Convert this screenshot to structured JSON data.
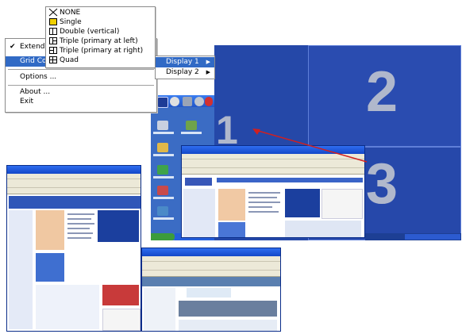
{
  "context_menu": {
    "items": [
      {
        "label": "Extend",
        "checked": true
      },
      {
        "label": "Grid Co",
        "highlighted": true
      },
      {
        "label": "Options ..."
      },
      {
        "label": "About ..."
      },
      {
        "label": "Exit"
      }
    ]
  },
  "grid_menu": {
    "items": [
      {
        "label": "NONE",
        "icon": "none-x-icon"
      },
      {
        "label": "Single",
        "icon": "single-grid-icon"
      },
      {
        "label": "Double (vertical)",
        "icon": "double-vertical-grid-icon"
      },
      {
        "label": "Triple (primary at left)",
        "icon": "triple-left-grid-icon"
      },
      {
        "label": "Triple (primary at right)",
        "icon": "triple-right-grid-icon"
      },
      {
        "label": "Quad",
        "icon": "quad-grid-icon"
      }
    ]
  },
  "display_menu": {
    "items": [
      {
        "label": "Display 1",
        "highlighted": true
      },
      {
        "label": "Display 2"
      }
    ]
  },
  "desktop": {
    "zones": [
      "1",
      "2",
      "3"
    ]
  },
  "colors": {
    "menu_highlight": "#316ac5",
    "desktop_blue": "#2548a8",
    "zone_number": "#b0b8cc",
    "arrow": "#d02020"
  }
}
